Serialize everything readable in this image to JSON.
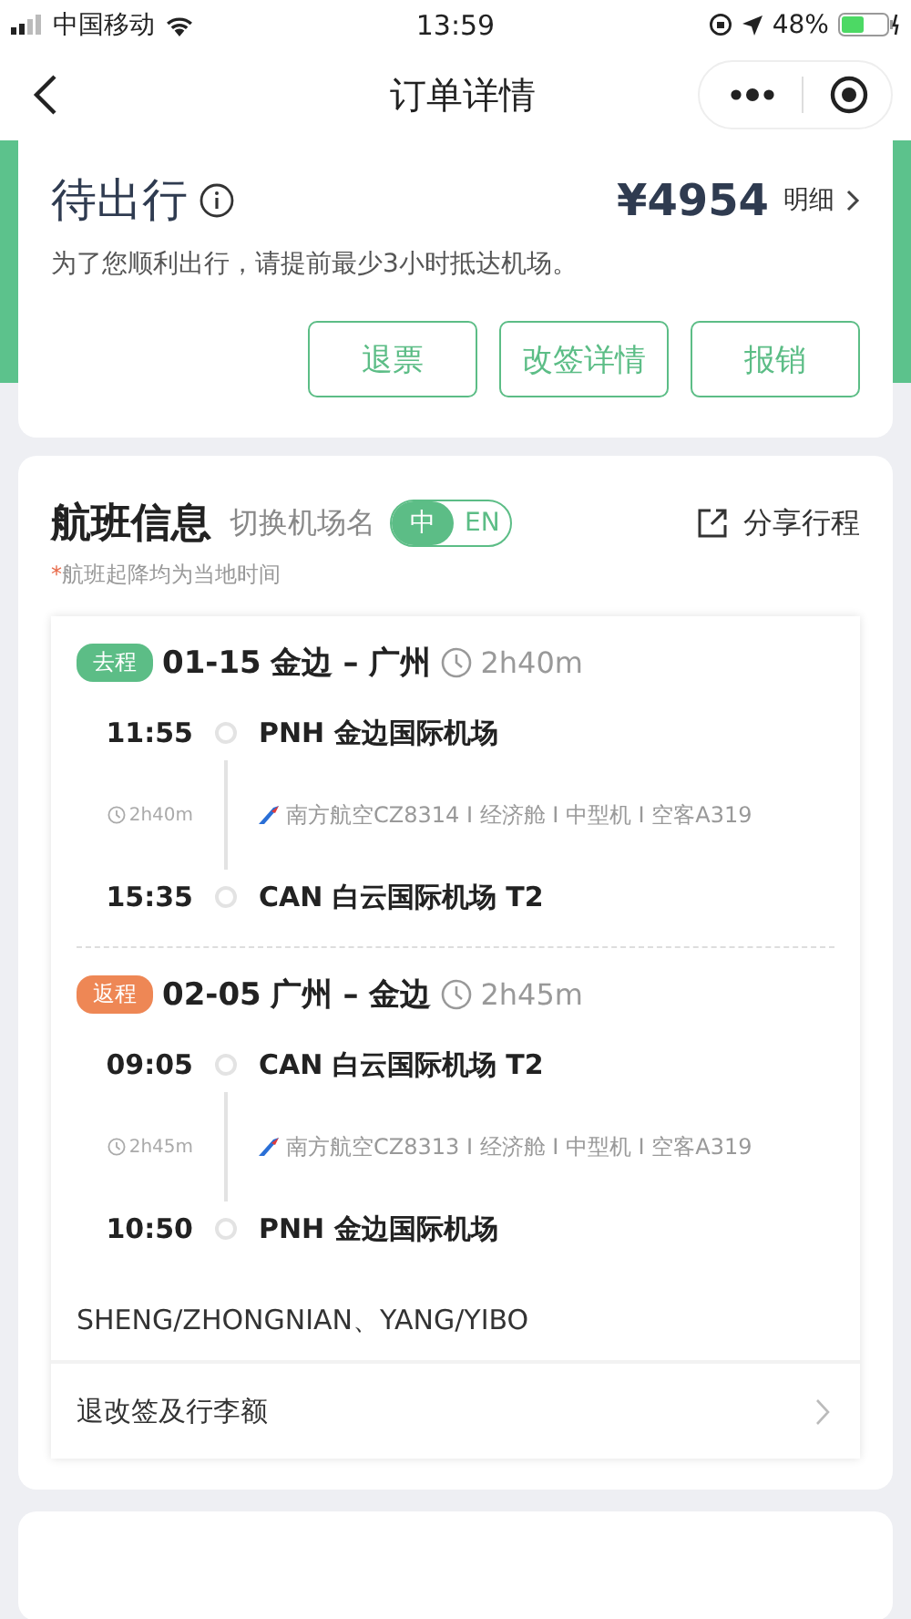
{
  "status_bar": {
    "carrier": "中国移动",
    "time": "13:59",
    "battery": "48%"
  },
  "nav": {
    "title": "订单详情"
  },
  "order": {
    "status": "待出行",
    "price": "¥4954",
    "price_link": "明细",
    "notice": "为了您顺利出行，请提前最少3小时抵达机场。",
    "buttons": [
      "退票",
      "改签详情",
      "报销"
    ]
  },
  "flight_info": {
    "title": "航班信息",
    "switch_label": "切换机场名",
    "toggle": [
      {
        "label": "中",
        "selected": true
      },
      {
        "label": "EN",
        "selected": false
      }
    ],
    "share": "分享行程",
    "note_mark": "*",
    "note": "航班起降均为当地时间",
    "segments": [
      {
        "tag": "去程",
        "color": "#5cbd86",
        "date": "01-15",
        "route": "金边 – 广州",
        "duration": "2h40m",
        "dep_time": "11:55",
        "dep_airport": "PNH 金边国际机场",
        "leg_duration": "2h40m",
        "flight": "南方航空CZ8314 I 经济舱 I 中型机 I 空客A319",
        "arr_time": "15:35",
        "arr_airport": "CAN 白云国际机场 T2"
      },
      {
        "tag": "返程",
        "color": "#ee8755",
        "date": "02-05",
        "route": "广州 – 金边",
        "duration": "2h45m",
        "dep_time": "09:05",
        "dep_airport": "CAN 白云国际机场 T2",
        "leg_duration": "2h45m",
        "flight": "南方航空CZ8313 I 经济舱 I 中型机 I 空客A319",
        "arr_time": "10:50",
        "arr_airport": "PNH 金边国际机场"
      }
    ],
    "passengers": "SHENG/ZHONGNIAN、YANG/YIBO",
    "rules_link": "退改签及行李额"
  }
}
